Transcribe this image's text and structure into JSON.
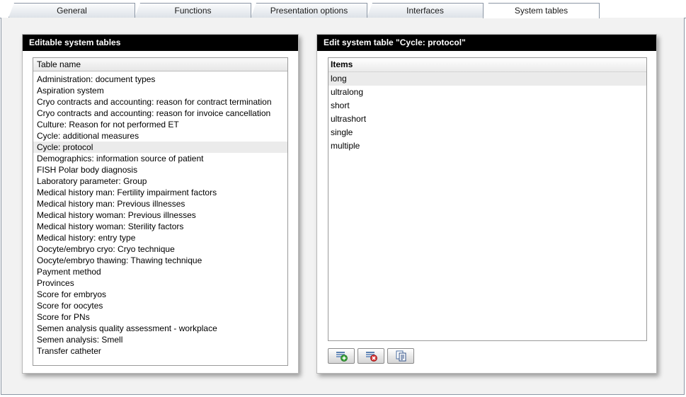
{
  "tabs": [
    "General",
    "Functions",
    "Presentation options",
    "Interfaces",
    "System tables"
  ],
  "active_tab": "System tables",
  "left_panel": {
    "title": "Editable system tables",
    "column_header": "Table name",
    "selected": "Cycle: protocol",
    "rows": [
      "Administration: document types",
      "Aspiration system",
      "Cryo contracts and accounting: reason for contract termination",
      "Cryo contracts and accounting: reason for invoice cancellation",
      "Culture: Reason for not performed ET",
      "Cycle: additional measures",
      "Cycle: protocol",
      "Demographics: information source of patient",
      "FISH Polar body diagnosis",
      "Laboratory parameter: Group",
      "Medical history man: Fertility impairment factors",
      "Medical history man: Previous illnesses",
      "Medical history woman: Previous illnesses",
      "Medical history woman: Sterility factors",
      "Medical history: entry type",
      "Oocyte/embryo cryo: Cryo technique",
      "Oocyte/embryo thawing: Thawing technique",
      "Payment method",
      "Provinces",
      "Score for embryos",
      "Score for oocytes",
      "Score for PNs",
      "Semen analysis quality assessment - workplace",
      "Semen analysis: Smell",
      "Transfer catheter"
    ]
  },
  "right_panel": {
    "title": "Edit system table \"Cycle: protocol\"",
    "column_header": "Items",
    "selected": "long",
    "items": [
      "long",
      "ultralong",
      "short",
      "ultrashort",
      "single",
      "multiple"
    ],
    "buttons": [
      {
        "name": "add-item-button",
        "icon": "add-row-icon"
      },
      {
        "name": "delete-item-button",
        "icon": "delete-row-icon"
      },
      {
        "name": "copy-item-button",
        "icon": "copy-document-icon"
      }
    ]
  }
}
